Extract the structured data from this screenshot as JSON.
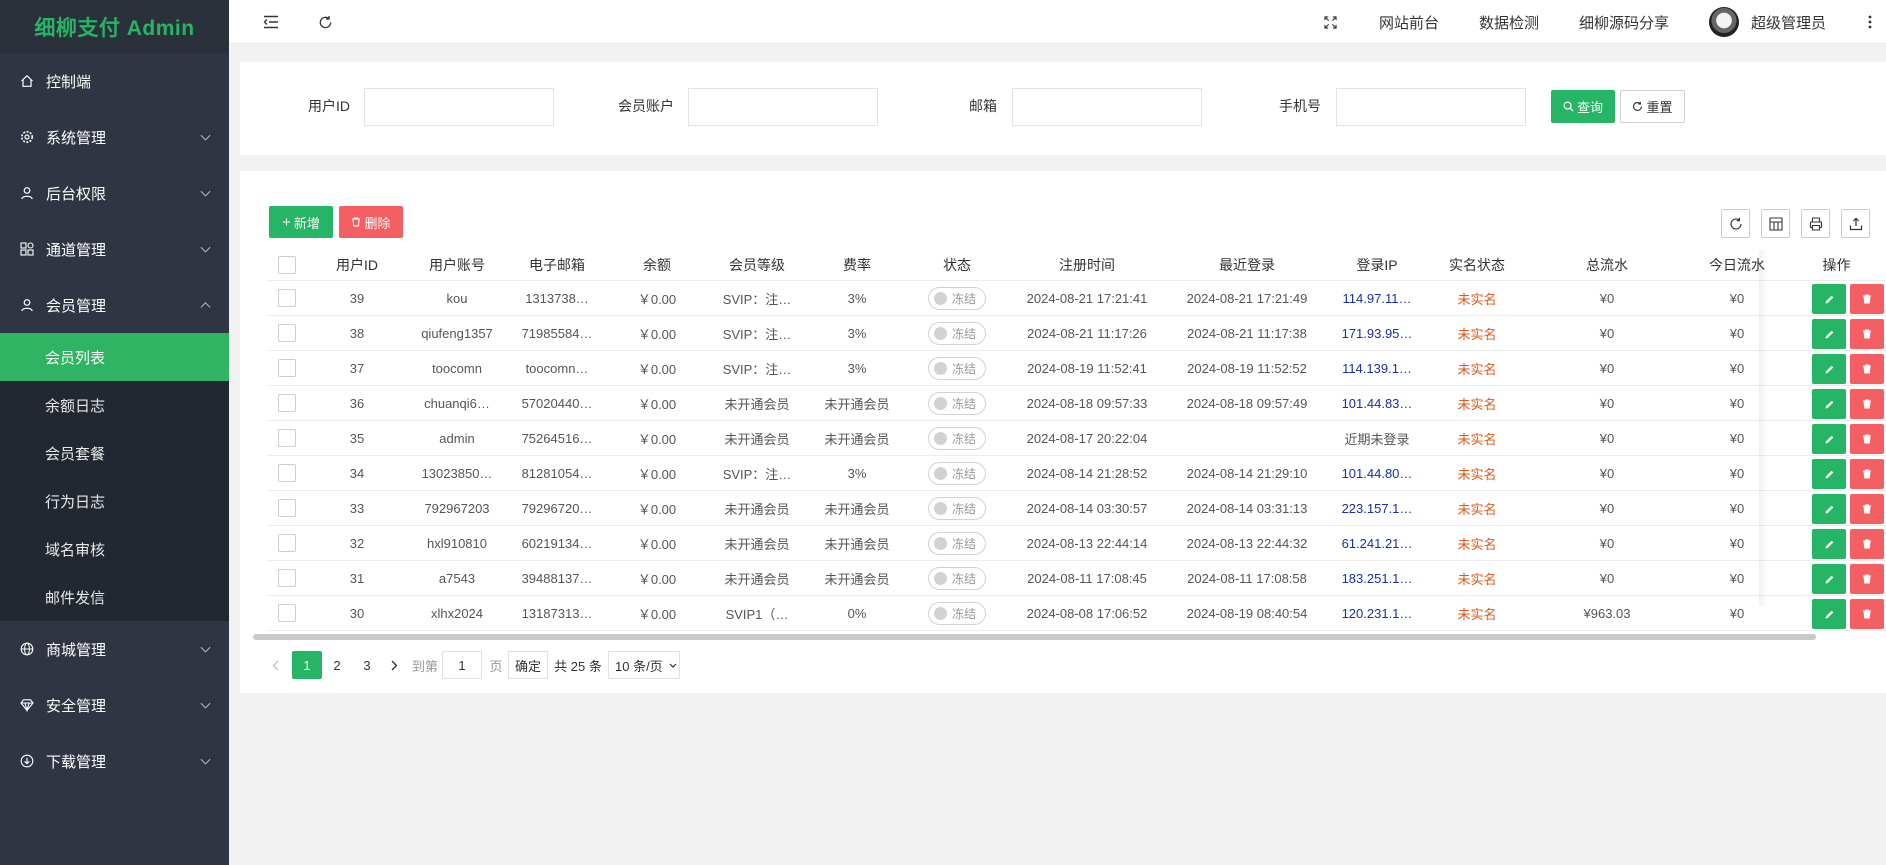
{
  "sidebar": {
    "brand": "细柳支付 Admin",
    "menu": [
      {
        "label": "控制端"
      },
      {
        "label": "系统管理"
      },
      {
        "label": "后台权限"
      },
      {
        "label": "通道管理"
      },
      {
        "label": "会员管理"
      }
    ],
    "submenu": [
      {
        "label": "会员列表"
      },
      {
        "label": "余额日志"
      },
      {
        "label": "会员套餐"
      },
      {
        "label": "行为日志"
      },
      {
        "label": "域名审核"
      },
      {
        "label": "邮件发信"
      }
    ],
    "menu_after": [
      {
        "label": "商城管理"
      },
      {
        "label": "安全管理"
      },
      {
        "label": "下载管理"
      }
    ]
  },
  "header": {
    "links": [
      "网站前台",
      "数据检测",
      "细柳源码分享"
    ],
    "user": "超级管理员"
  },
  "search": {
    "fields": [
      {
        "label": "用户ID",
        "value": ""
      },
      {
        "label": "会员账户",
        "value": ""
      },
      {
        "label": "邮箱",
        "value": ""
      },
      {
        "label": "手机号",
        "value": ""
      }
    ],
    "query_label": "查询",
    "reset_label": "重置"
  },
  "toolbar": {
    "add_label": "新增",
    "delete_label": "删除"
  },
  "table": {
    "headers": [
      "用户ID",
      "用户账号",
      "电子邮箱",
      "余额",
      "会员等级",
      "费率",
      "状态",
      "注册时间",
      "最近登录",
      "登录IP",
      "实名状态",
      "总流水",
      "今日流水",
      "操作"
    ],
    "rows": [
      {
        "id": "39",
        "account": "kou",
        "email": "1313738…",
        "balance": "￥0.00",
        "level": "SVIP：注…",
        "rate": "3%",
        "status": "冻结",
        "reg": "2024-08-21 17:21:41",
        "login": "2024-08-21 17:21:49",
        "ip": "114.97.11…",
        "realname": "未实名",
        "total": "¥0",
        "today": "¥0"
      },
      {
        "id": "38",
        "account": "qiufeng1357",
        "email": "71985584…",
        "balance": "￥0.00",
        "level": "SVIP：注…",
        "rate": "3%",
        "status": "冻结",
        "reg": "2024-08-21 11:17:26",
        "login": "2024-08-21 11:17:38",
        "ip": "171.93.95…",
        "realname": "未实名",
        "total": "¥0",
        "today": "¥0"
      },
      {
        "id": "37",
        "account": "toocomn",
        "email": "toocomn…",
        "balance": "￥0.00",
        "level": "SVIP：注…",
        "rate": "3%",
        "status": "冻结",
        "reg": "2024-08-19 11:52:41",
        "login": "2024-08-19 11:52:52",
        "ip": "114.139.1…",
        "realname": "未实名",
        "total": "¥0",
        "today": "¥0"
      },
      {
        "id": "36",
        "account": "chuanqi6…",
        "email": "57020440…",
        "balance": "￥0.00",
        "level": "未开通会员",
        "rate": "未开通会员",
        "status": "冻结",
        "reg": "2024-08-18 09:57:33",
        "login": "2024-08-18 09:57:49",
        "ip": "101.44.83…",
        "realname": "未实名",
        "total": "¥0",
        "today": "¥0"
      },
      {
        "id": "35",
        "account": "admin",
        "email": "75264516…",
        "balance": "￥0.00",
        "level": "未开通会员",
        "rate": "未开通会员",
        "status": "冻结",
        "reg": "2024-08-17 20:22:04",
        "login": "",
        "ip": "近期未登录",
        "realname": "未实名",
        "total": "¥0",
        "today": "¥0"
      },
      {
        "id": "34",
        "account": "13023850…",
        "email": "81281054…",
        "balance": "￥0.00",
        "level": "SVIP：注…",
        "rate": "3%",
        "status": "冻结",
        "reg": "2024-08-14 21:28:52",
        "login": "2024-08-14 21:29:10",
        "ip": "101.44.80…",
        "realname": "未实名",
        "total": "¥0",
        "today": "¥0"
      },
      {
        "id": "33",
        "account": "792967203",
        "email": "79296720…",
        "balance": "￥0.00",
        "level": "未开通会员",
        "rate": "未开通会员",
        "status": "冻结",
        "reg": "2024-08-14 03:30:57",
        "login": "2024-08-14 03:31:13",
        "ip": "223.157.1…",
        "realname": "未实名",
        "total": "¥0",
        "today": "¥0"
      },
      {
        "id": "32",
        "account": "hxl910810",
        "email": "60219134…",
        "balance": "￥0.00",
        "level": "未开通会员",
        "rate": "未开通会员",
        "status": "冻结",
        "reg": "2024-08-13 22:44:14",
        "login": "2024-08-13 22:44:32",
        "ip": "61.241.21…",
        "realname": "未实名",
        "total": "¥0",
        "today": "¥0"
      },
      {
        "id": "31",
        "account": "a7543",
        "email": "39488137…",
        "balance": "￥0.00",
        "level": "未开通会员",
        "rate": "未开通会员",
        "status": "冻结",
        "reg": "2024-08-11 17:08:45",
        "login": "2024-08-11 17:08:58",
        "ip": "183.251.1…",
        "realname": "未实名",
        "total": "¥0",
        "today": "¥0"
      },
      {
        "id": "30",
        "account": "xlhx2024",
        "email": "13187313…",
        "balance": "￥0.00",
        "level": "SVIP1（…",
        "rate": "0%",
        "status": "冻结",
        "reg": "2024-08-08 17:06:52",
        "login": "2024-08-19 08:40:54",
        "ip": "120.231.1…",
        "realname": "未实名",
        "total": "¥963.03",
        "today": "¥0"
      }
    ]
  },
  "pager": {
    "pages": [
      "1",
      "2",
      "3"
    ],
    "current": "1",
    "goto_label": "到第",
    "goto_value": "1",
    "page_unit": "页",
    "confirm_label": "确定",
    "total_label": "共 25 条",
    "size_label": "10 条/页"
  },
  "colors": {
    "brand_green": "#25b564",
    "danger_red": "#f35f62",
    "sidebar_bg": "#2f3542",
    "ip_blue": "#1a2fa5",
    "realname_orange": "#e0591b"
  }
}
